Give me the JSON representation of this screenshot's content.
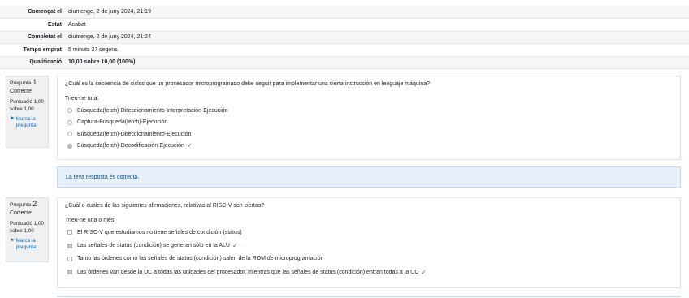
{
  "summary": [
    {
      "label": "Començat el",
      "value": "diumenge, 2 de juny 2024, 21:19"
    },
    {
      "label": "Estat",
      "value": "Acabat"
    },
    {
      "label": "Completat el",
      "value": "diumenge, 2 de juny 2024, 21:24"
    },
    {
      "label": "Temps emprat",
      "value": "5 minuts 37 segons"
    },
    {
      "label": "Qualificació",
      "value": "10,00 sobre 10,00 (100%)"
    }
  ],
  "questions": [
    {
      "label": "Pregunta",
      "number": "1",
      "state": "Correcte",
      "grade": "Puntuació 1,00 sobre 1,00",
      "flag": "Marca la pregunta",
      "text": "¿Cuál es la secuencia de ciclos que un procesador microprogramado debe seguir para implementar una cierta instrucción en lenguaje máquina?",
      "prompt": "Trieu-ne una:",
      "options": [
        "Búsqueda(fetch)-Direccionamiento-Interpretación-Ejecución",
        "Captura-Búsqueda(fetch)-Ejecución",
        "Búsqueda(fetch)-Direccionamiento-Ejecución",
        "Búsqueda(fetch)-Decodificación-Ejecución"
      ],
      "feedback": "La teva resposta és correcta."
    },
    {
      "label": "Pregunta",
      "number": "2",
      "state": "Correcte",
      "grade": "Puntuació 1,00 sobre 1,00",
      "flag": "Marca la pregunta",
      "text": "¿Cuál o cuáles de las siguientes afirmaciones, relativas al RISC-V son ciertas?",
      "prompt": "Trieu-ne una o més:",
      "options": [
        "El RISC-V que estudiamos no tiene señales de condición (status)",
        "Las señales de status (condición) se generan sólo en la ALU",
        "Tanto las órdenes como las señales de status (condición) salen de la ROM de microprogramación",
        "Las órdenes van desde la UC a todas las unidades del procesador, mientras que las señales de status (condición) entran todas a la UC"
      ]
    }
  ]
}
